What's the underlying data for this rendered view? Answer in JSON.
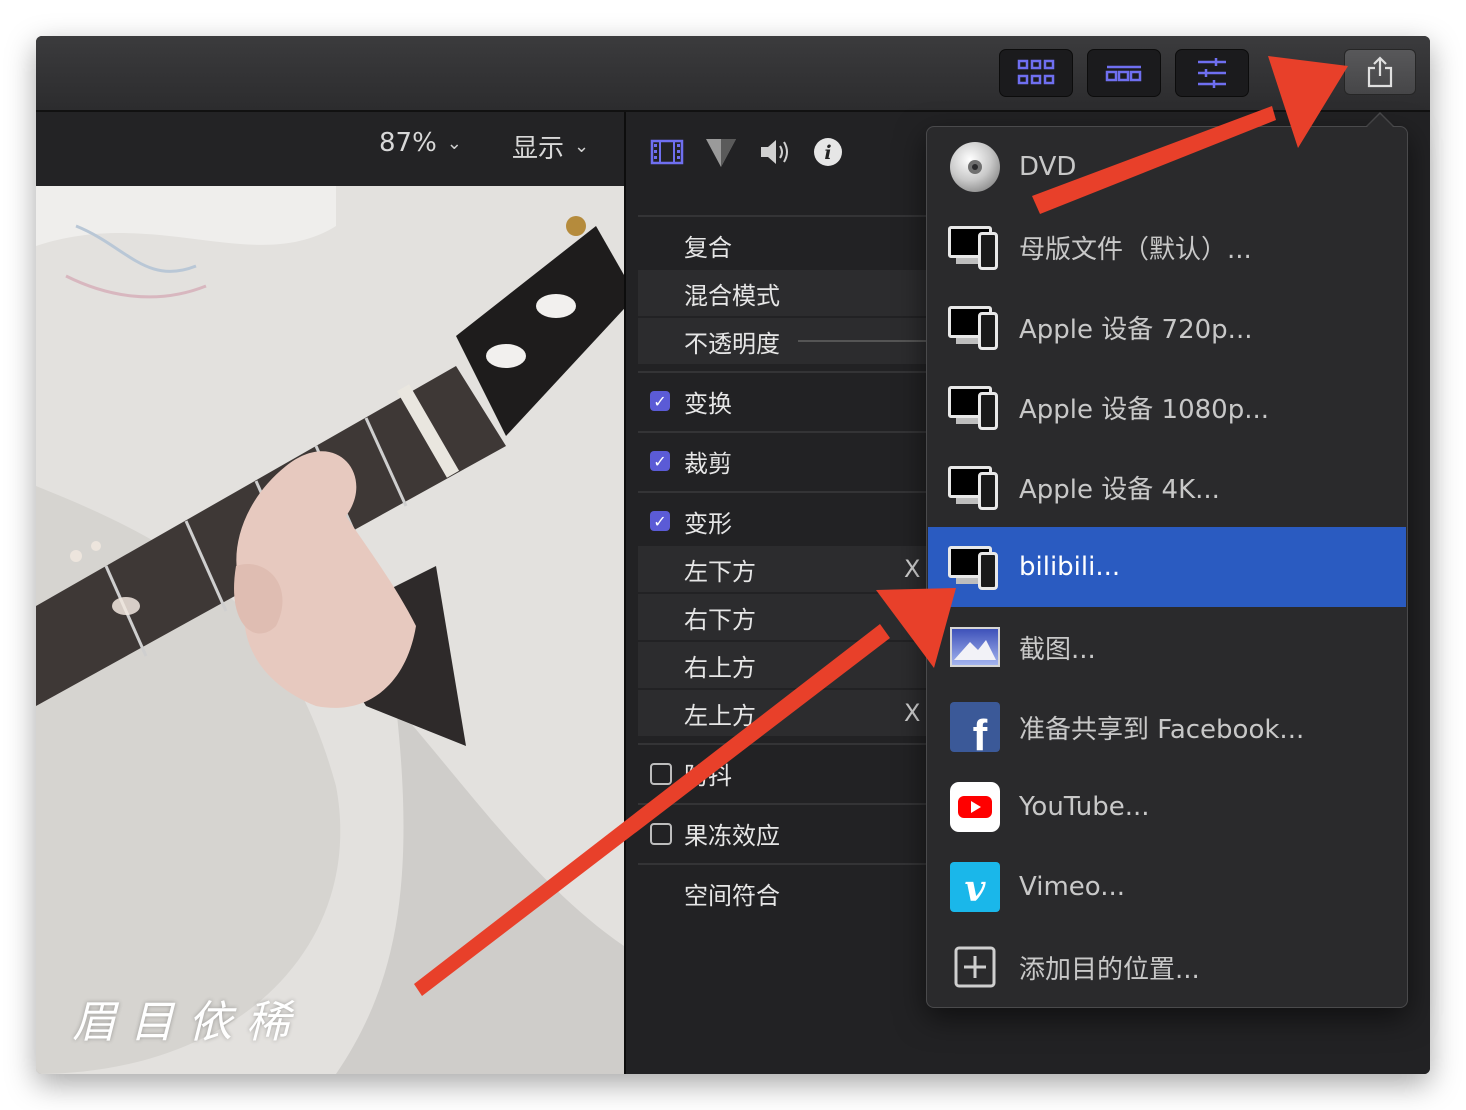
{
  "viewer": {
    "zoom_label": "87%",
    "view_label": "显示",
    "subtitle": "眉目依稀"
  },
  "inspector": {
    "rows": {
      "composite": "复合",
      "blend_mode": "混合模式",
      "opacity": "不透明度",
      "transform": "变换",
      "crop": "裁剪",
      "distort": "变形",
      "bottom_left": "左下方",
      "bottom_right": "右下方",
      "top_right": "右上方",
      "top_left": "左上方",
      "stabilization": "防抖",
      "rolling_shutter": "果冻效应",
      "spatial_conform": "空间符合"
    },
    "x_label": "X"
  },
  "share_menu": {
    "items": [
      {
        "label": "DVD",
        "icon": "dvd-icon"
      },
      {
        "label": "母版文件（默认）...",
        "icon": "device-icon"
      },
      {
        "label": "Apple 设备 720p...",
        "icon": "device-icon"
      },
      {
        "label": "Apple 设备 1080p...",
        "icon": "device-icon"
      },
      {
        "label": "Apple 设备 4K...",
        "icon": "device-icon"
      },
      {
        "label": "bilibili...",
        "icon": "device-icon",
        "selected": true
      },
      {
        "label": "截图...",
        "icon": "image-icon"
      },
      {
        "label": "准备共享到 Facebook...",
        "icon": "facebook-icon"
      },
      {
        "label": "YouTube...",
        "icon": "youtube-icon"
      },
      {
        "label": "Vimeo...",
        "icon": "vimeo-icon"
      },
      {
        "label": "添加目的位置...",
        "icon": "plus-icon"
      }
    ]
  },
  "colors": {
    "accent": "#5b5bd6",
    "selection": "#2a5bc1",
    "arrow": "#e8402a",
    "facebook": "#3b5998",
    "youtube": "#ff0000",
    "vimeo": "#1ab7ea"
  }
}
